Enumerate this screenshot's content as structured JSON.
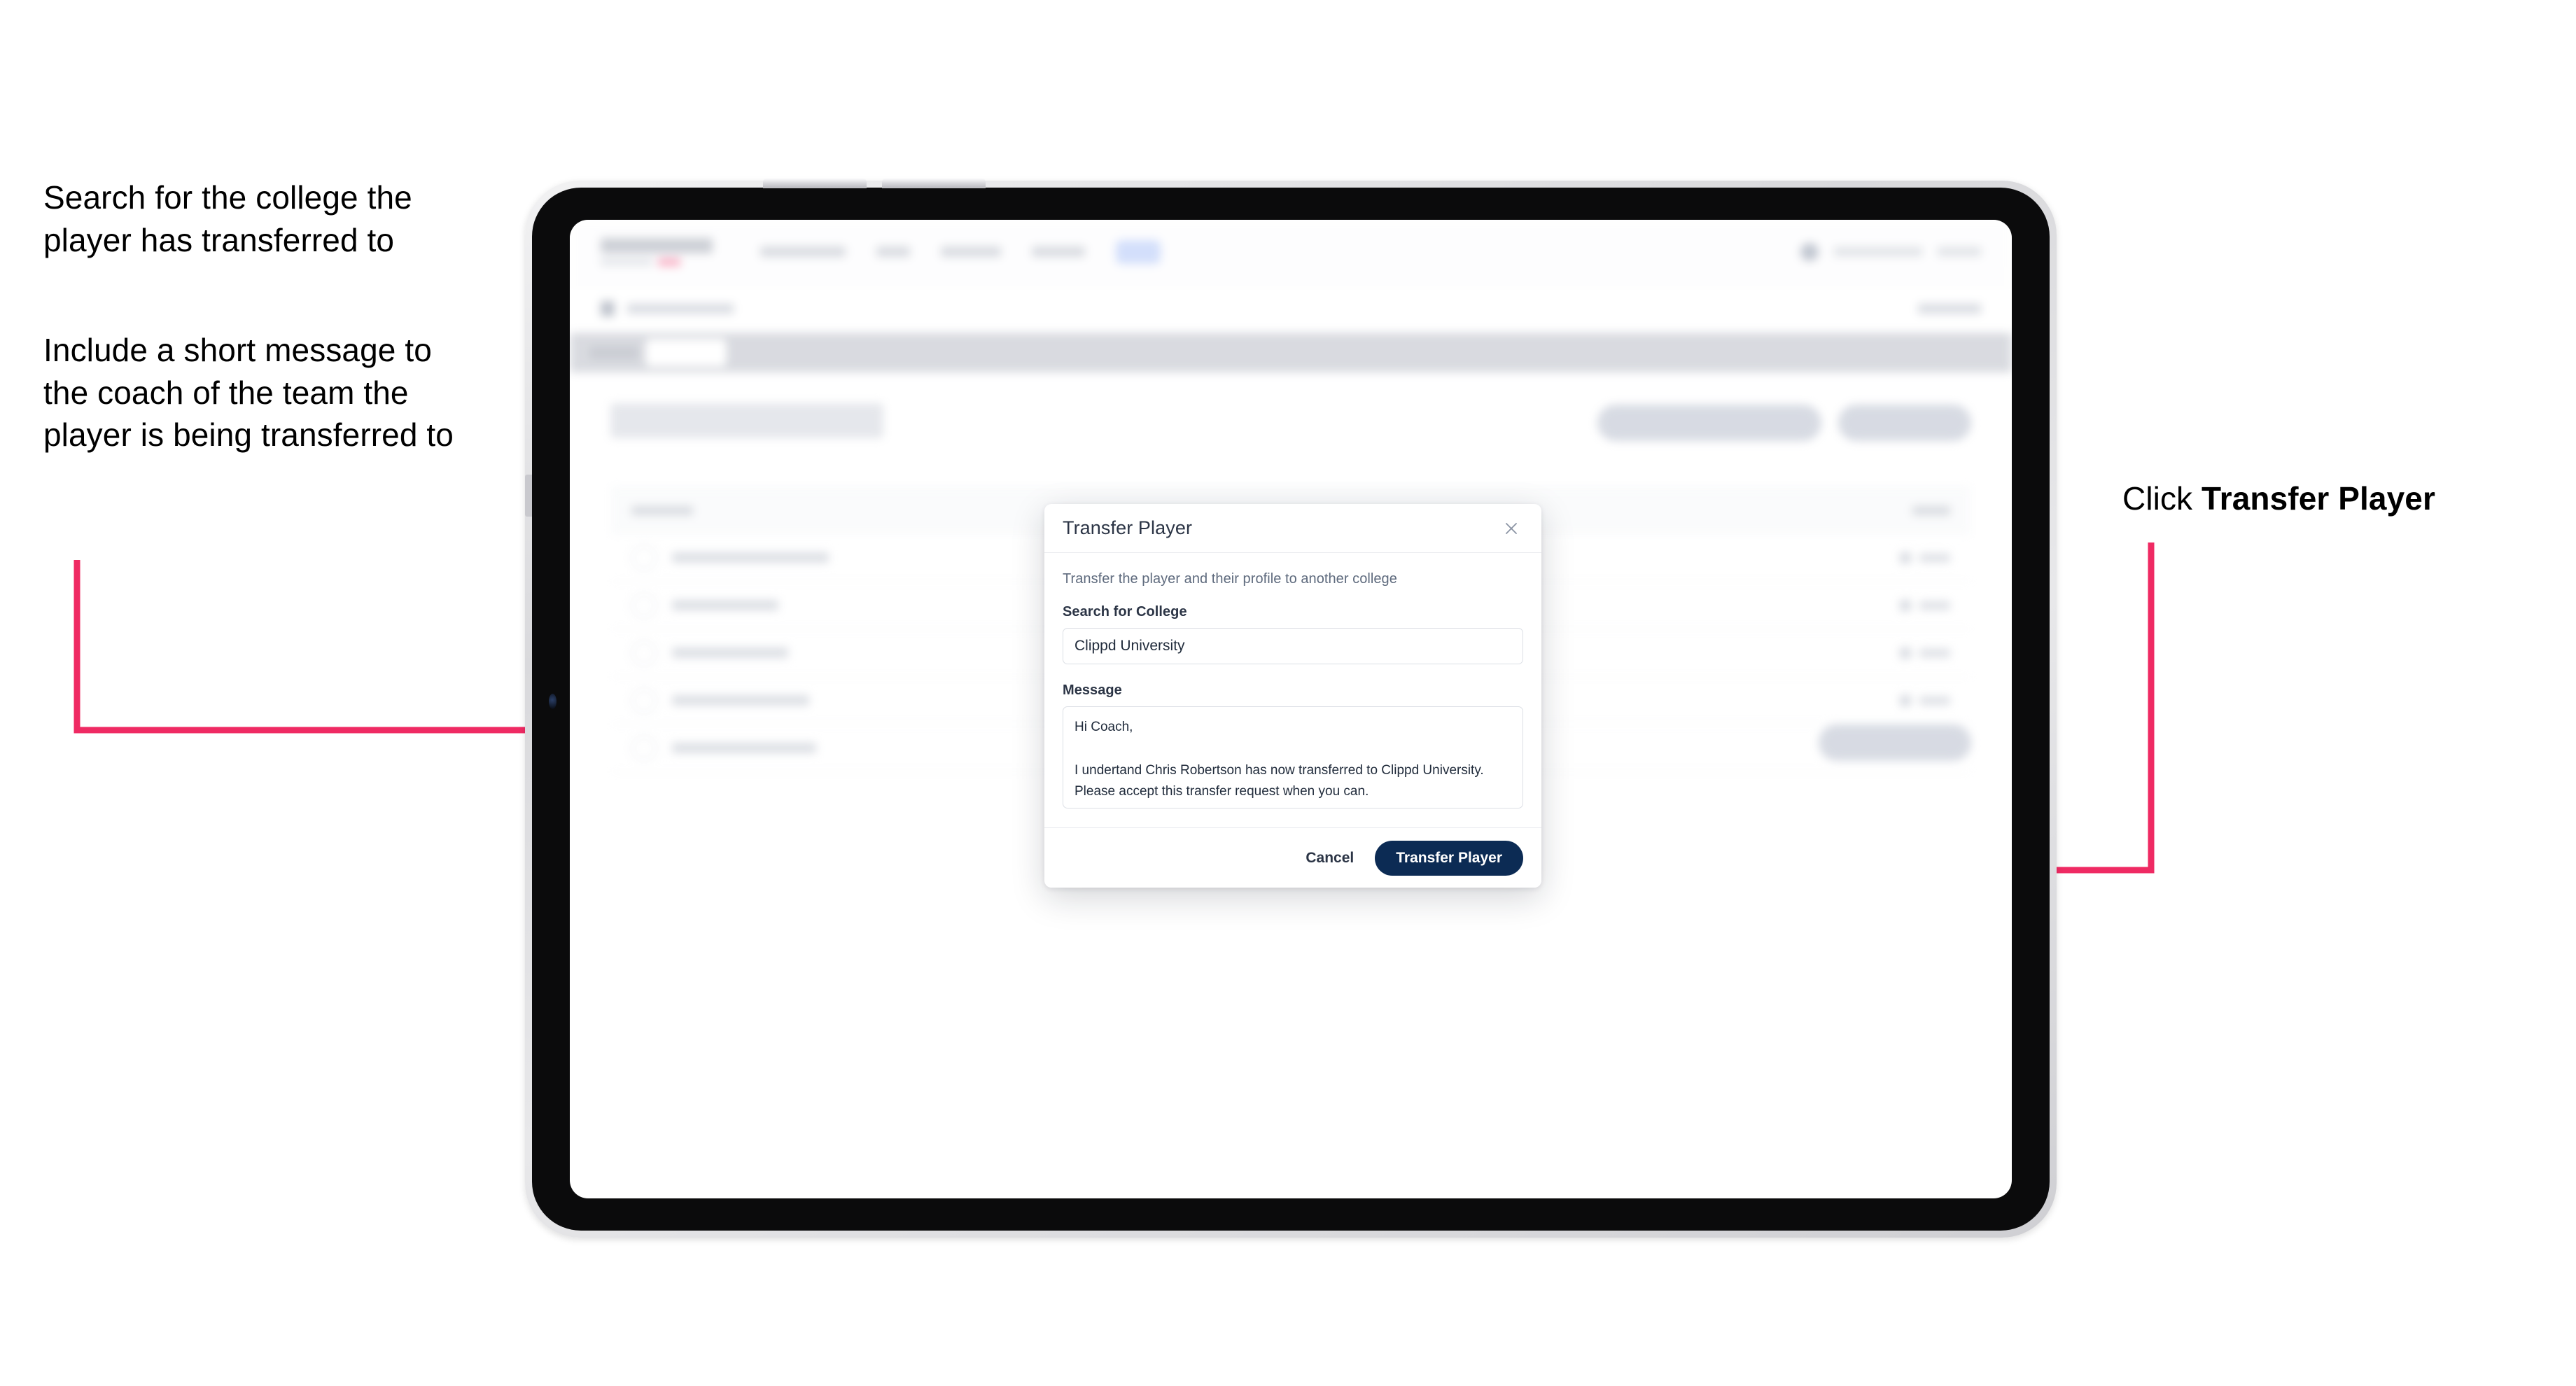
{
  "annotations": {
    "left_1": "Search for the college the player has transferred to",
    "left_2": "Include a short message to the coach of the team the player is being transferred to",
    "right_prefix": "Click ",
    "right_bold": "Transfer Player",
    "arrow_color": "#ef2a63"
  },
  "device": {
    "type": "tablet",
    "volume_up": "volume-up-button",
    "volume_down": "volume-down-button",
    "front_camera": "front-camera"
  },
  "app": {
    "brand": "SCOREBOARD",
    "page_title": "Update Roster",
    "nav": [
      "Tournaments",
      "Teams",
      "Leaderboard",
      "World POTY",
      "Roster"
    ],
    "breadcrumb": "Scoreboard Home",
    "breadcrumb_action": "Cancel",
    "tabs": [
      "Details",
      "Roster"
    ],
    "active_tab": "Roster",
    "actions": [
      "Request Team Transfer",
      "Add Player"
    ],
    "table_headers": [
      "Name",
      "EDIT"
    ],
    "rows": [
      {
        "name": "Chris Robertson",
        "edit": "Edit"
      },
      {
        "name": "Ian Winter",
        "edit": "Edit"
      },
      {
        "name": "John Taylor",
        "edit": "Edit"
      },
      {
        "name": "Lewis Thornton",
        "edit": "Edit"
      },
      {
        "name": "Nathan Holmes",
        "edit": "Edit"
      }
    ],
    "save_button": "Save Roster Updates",
    "user_name": "coach@clippd.io",
    "sign_out": "Sign Out"
  },
  "modal": {
    "title": "Transfer Player",
    "close_icon": "close-icon",
    "description": "Transfer the player and their profile to another college",
    "college_label": "Search for College",
    "college_value": "Clippd University",
    "college_placeholder": "Search for College",
    "message_label": "Message",
    "message_value": "Hi Coach,\n\nI undertand Chris Robertson has now transferred to Clippd University. Please accept this transfer request when you can.",
    "message_placeholder": "Message",
    "cancel_label": "Cancel",
    "submit_label": "Transfer Player",
    "submit_color": "#0c2b54"
  }
}
